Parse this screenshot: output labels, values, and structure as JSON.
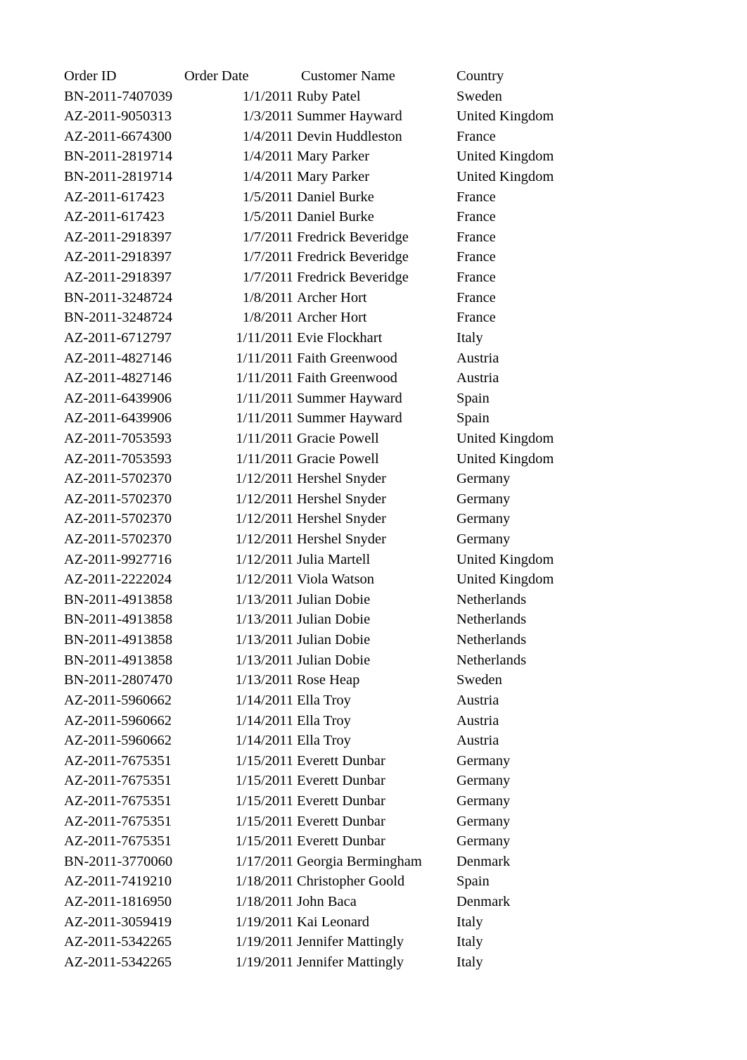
{
  "table": {
    "headers": {
      "order_id": "Order ID",
      "order_date": "Order Date",
      "customer_name": "Customer Name",
      "country": "Country"
    },
    "rows": [
      {
        "order_id": "BN-2011-7407039",
        "order_date": "1/1/2011",
        "customer_name": "Ruby Patel",
        "country": "Sweden"
      },
      {
        "order_id": "AZ-2011-9050313",
        "order_date": "1/3/2011",
        "customer_name": "Summer Hayward",
        "country": "United Kingdom"
      },
      {
        "order_id": "AZ-2011-6674300",
        "order_date": "1/4/2011",
        "customer_name": "Devin Huddleston",
        "country": "France"
      },
      {
        "order_id": "BN-2011-2819714",
        "order_date": "1/4/2011",
        "customer_name": "Mary Parker",
        "country": "United Kingdom"
      },
      {
        "order_id": "BN-2011-2819714",
        "order_date": "1/4/2011",
        "customer_name": "Mary Parker",
        "country": "United Kingdom"
      },
      {
        "order_id": "AZ-2011-617423",
        "order_date": "1/5/2011",
        "customer_name": "Daniel Burke",
        "country": "France"
      },
      {
        "order_id": "AZ-2011-617423",
        "order_date": "1/5/2011",
        "customer_name": "Daniel Burke",
        "country": "France"
      },
      {
        "order_id": "AZ-2011-2918397",
        "order_date": "1/7/2011",
        "customer_name": "Fredrick Beveridge",
        "country": "France"
      },
      {
        "order_id": "AZ-2011-2918397",
        "order_date": "1/7/2011",
        "customer_name": "Fredrick Beveridge",
        "country": "France"
      },
      {
        "order_id": "AZ-2011-2918397",
        "order_date": "1/7/2011",
        "customer_name": "Fredrick Beveridge",
        "country": "France"
      },
      {
        "order_id": "BN-2011-3248724",
        "order_date": "1/8/2011",
        "customer_name": "Archer Hort",
        "country": "France"
      },
      {
        "order_id": "BN-2011-3248724",
        "order_date": "1/8/2011",
        "customer_name": "Archer Hort",
        "country": "France"
      },
      {
        "order_id": "AZ-2011-6712797",
        "order_date": "1/11/2011",
        "customer_name": "Evie Flockhart",
        "country": "Italy"
      },
      {
        "order_id": "AZ-2011-4827146",
        "order_date": "1/11/2011",
        "customer_name": "Faith Greenwood",
        "country": "Austria"
      },
      {
        "order_id": "AZ-2011-4827146",
        "order_date": "1/11/2011",
        "customer_name": "Faith Greenwood",
        "country": "Austria"
      },
      {
        "order_id": "AZ-2011-6439906",
        "order_date": "1/11/2011",
        "customer_name": "Summer Hayward",
        "country": "Spain"
      },
      {
        "order_id": "AZ-2011-6439906",
        "order_date": "1/11/2011",
        "customer_name": "Summer Hayward",
        "country": "Spain"
      },
      {
        "order_id": "AZ-2011-7053593",
        "order_date": "1/11/2011",
        "customer_name": "Gracie Powell",
        "country": "United Kingdom"
      },
      {
        "order_id": "AZ-2011-7053593",
        "order_date": "1/11/2011",
        "customer_name": "Gracie Powell",
        "country": "United Kingdom"
      },
      {
        "order_id": "AZ-2011-5702370",
        "order_date": "1/12/2011",
        "customer_name": "Hershel Snyder",
        "country": "Germany"
      },
      {
        "order_id": "AZ-2011-5702370",
        "order_date": "1/12/2011",
        "customer_name": "Hershel Snyder",
        "country": "Germany"
      },
      {
        "order_id": "AZ-2011-5702370",
        "order_date": "1/12/2011",
        "customer_name": "Hershel Snyder",
        "country": "Germany"
      },
      {
        "order_id": "AZ-2011-5702370",
        "order_date": "1/12/2011",
        "customer_name": "Hershel Snyder",
        "country": "Germany"
      },
      {
        "order_id": "AZ-2011-9927716",
        "order_date": "1/12/2011",
        "customer_name": "Julia Martell",
        "country": "United Kingdom"
      },
      {
        "order_id": "AZ-2011-2222024",
        "order_date": "1/12/2011",
        "customer_name": "Viola Watson",
        "country": "United Kingdom"
      },
      {
        "order_id": "BN-2011-4913858",
        "order_date": "1/13/2011",
        "customer_name": "Julian Dobie",
        "country": "Netherlands"
      },
      {
        "order_id": "BN-2011-4913858",
        "order_date": "1/13/2011",
        "customer_name": "Julian Dobie",
        "country": "Netherlands"
      },
      {
        "order_id": "BN-2011-4913858",
        "order_date": "1/13/2011",
        "customer_name": "Julian Dobie",
        "country": "Netherlands"
      },
      {
        "order_id": "BN-2011-4913858",
        "order_date": "1/13/2011",
        "customer_name": "Julian Dobie",
        "country": "Netherlands"
      },
      {
        "order_id": "BN-2011-2807470",
        "order_date": "1/13/2011",
        "customer_name": "Rose Heap",
        "country": "Sweden"
      },
      {
        "order_id": "AZ-2011-5960662",
        "order_date": "1/14/2011",
        "customer_name": "Ella Troy",
        "country": "Austria"
      },
      {
        "order_id": "AZ-2011-5960662",
        "order_date": "1/14/2011",
        "customer_name": "Ella Troy",
        "country": "Austria"
      },
      {
        "order_id": "AZ-2011-5960662",
        "order_date": "1/14/2011",
        "customer_name": "Ella Troy",
        "country": "Austria"
      },
      {
        "order_id": "AZ-2011-7675351",
        "order_date": "1/15/2011",
        "customer_name": "Everett Dunbar",
        "country": "Germany"
      },
      {
        "order_id": "AZ-2011-7675351",
        "order_date": "1/15/2011",
        "customer_name": "Everett Dunbar",
        "country": "Germany"
      },
      {
        "order_id": "AZ-2011-7675351",
        "order_date": "1/15/2011",
        "customer_name": "Everett Dunbar",
        "country": "Germany"
      },
      {
        "order_id": "AZ-2011-7675351",
        "order_date": "1/15/2011",
        "customer_name": "Everett Dunbar",
        "country": "Germany"
      },
      {
        "order_id": "AZ-2011-7675351",
        "order_date": "1/15/2011",
        "customer_name": "Everett Dunbar",
        "country": "Germany"
      },
      {
        "order_id": "BN-2011-3770060",
        "order_date": "1/17/2011",
        "customer_name": "Georgia Bermingham",
        "country": "Denmark"
      },
      {
        "order_id": "AZ-2011-7419210",
        "order_date": "1/18/2011",
        "customer_name": "Christopher Goold",
        "country": "Spain"
      },
      {
        "order_id": "AZ-2011-1816950",
        "order_date": "1/18/2011",
        "customer_name": "John Baca",
        "country": "Denmark"
      },
      {
        "order_id": "AZ-2011-3059419",
        "order_date": "1/19/2011",
        "customer_name": "Kai Leonard",
        "country": "Italy"
      },
      {
        "order_id": "AZ-2011-5342265",
        "order_date": "1/19/2011",
        "customer_name": "Jennifer Mattingly",
        "country": "Italy"
      },
      {
        "order_id": "AZ-2011-5342265",
        "order_date": "1/19/2011",
        "customer_name": "Jennifer Mattingly",
        "country": "Italy"
      }
    ]
  }
}
